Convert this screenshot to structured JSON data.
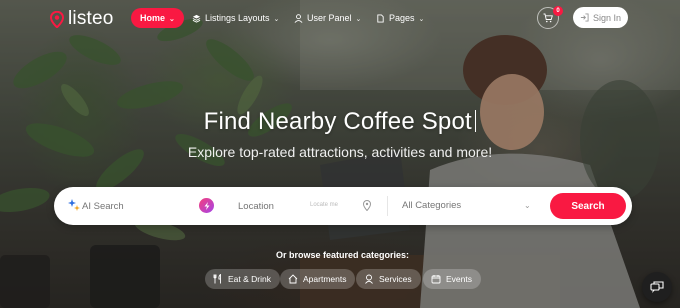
{
  "brand": {
    "name": "listeo",
    "accent": "#f91942"
  },
  "nav": {
    "home": "Home",
    "listings": "Listings Layouts",
    "user_panel": "User Panel",
    "pages": "Pages"
  },
  "header_actions": {
    "cart_count": "0",
    "sign_in": "Sign In"
  },
  "hero": {
    "title": "Find Nearby Coffee Spot",
    "subtitle": "Explore top-rated attractions, activities and more!"
  },
  "search": {
    "ai_placeholder": "AI Search",
    "location_placeholder": "Location",
    "location_hint": "Locate me",
    "category_selected": "All Categories",
    "button": "Search"
  },
  "featured": {
    "heading": "Or browse featured categories:",
    "categories": [
      {
        "label": "Eat & Drink",
        "icon": "utensils-icon"
      },
      {
        "label": "Apartments",
        "icon": "house-icon"
      },
      {
        "label": "Services",
        "icon": "services-icon"
      },
      {
        "label": "Events",
        "icon": "ticket-icon"
      }
    ]
  }
}
